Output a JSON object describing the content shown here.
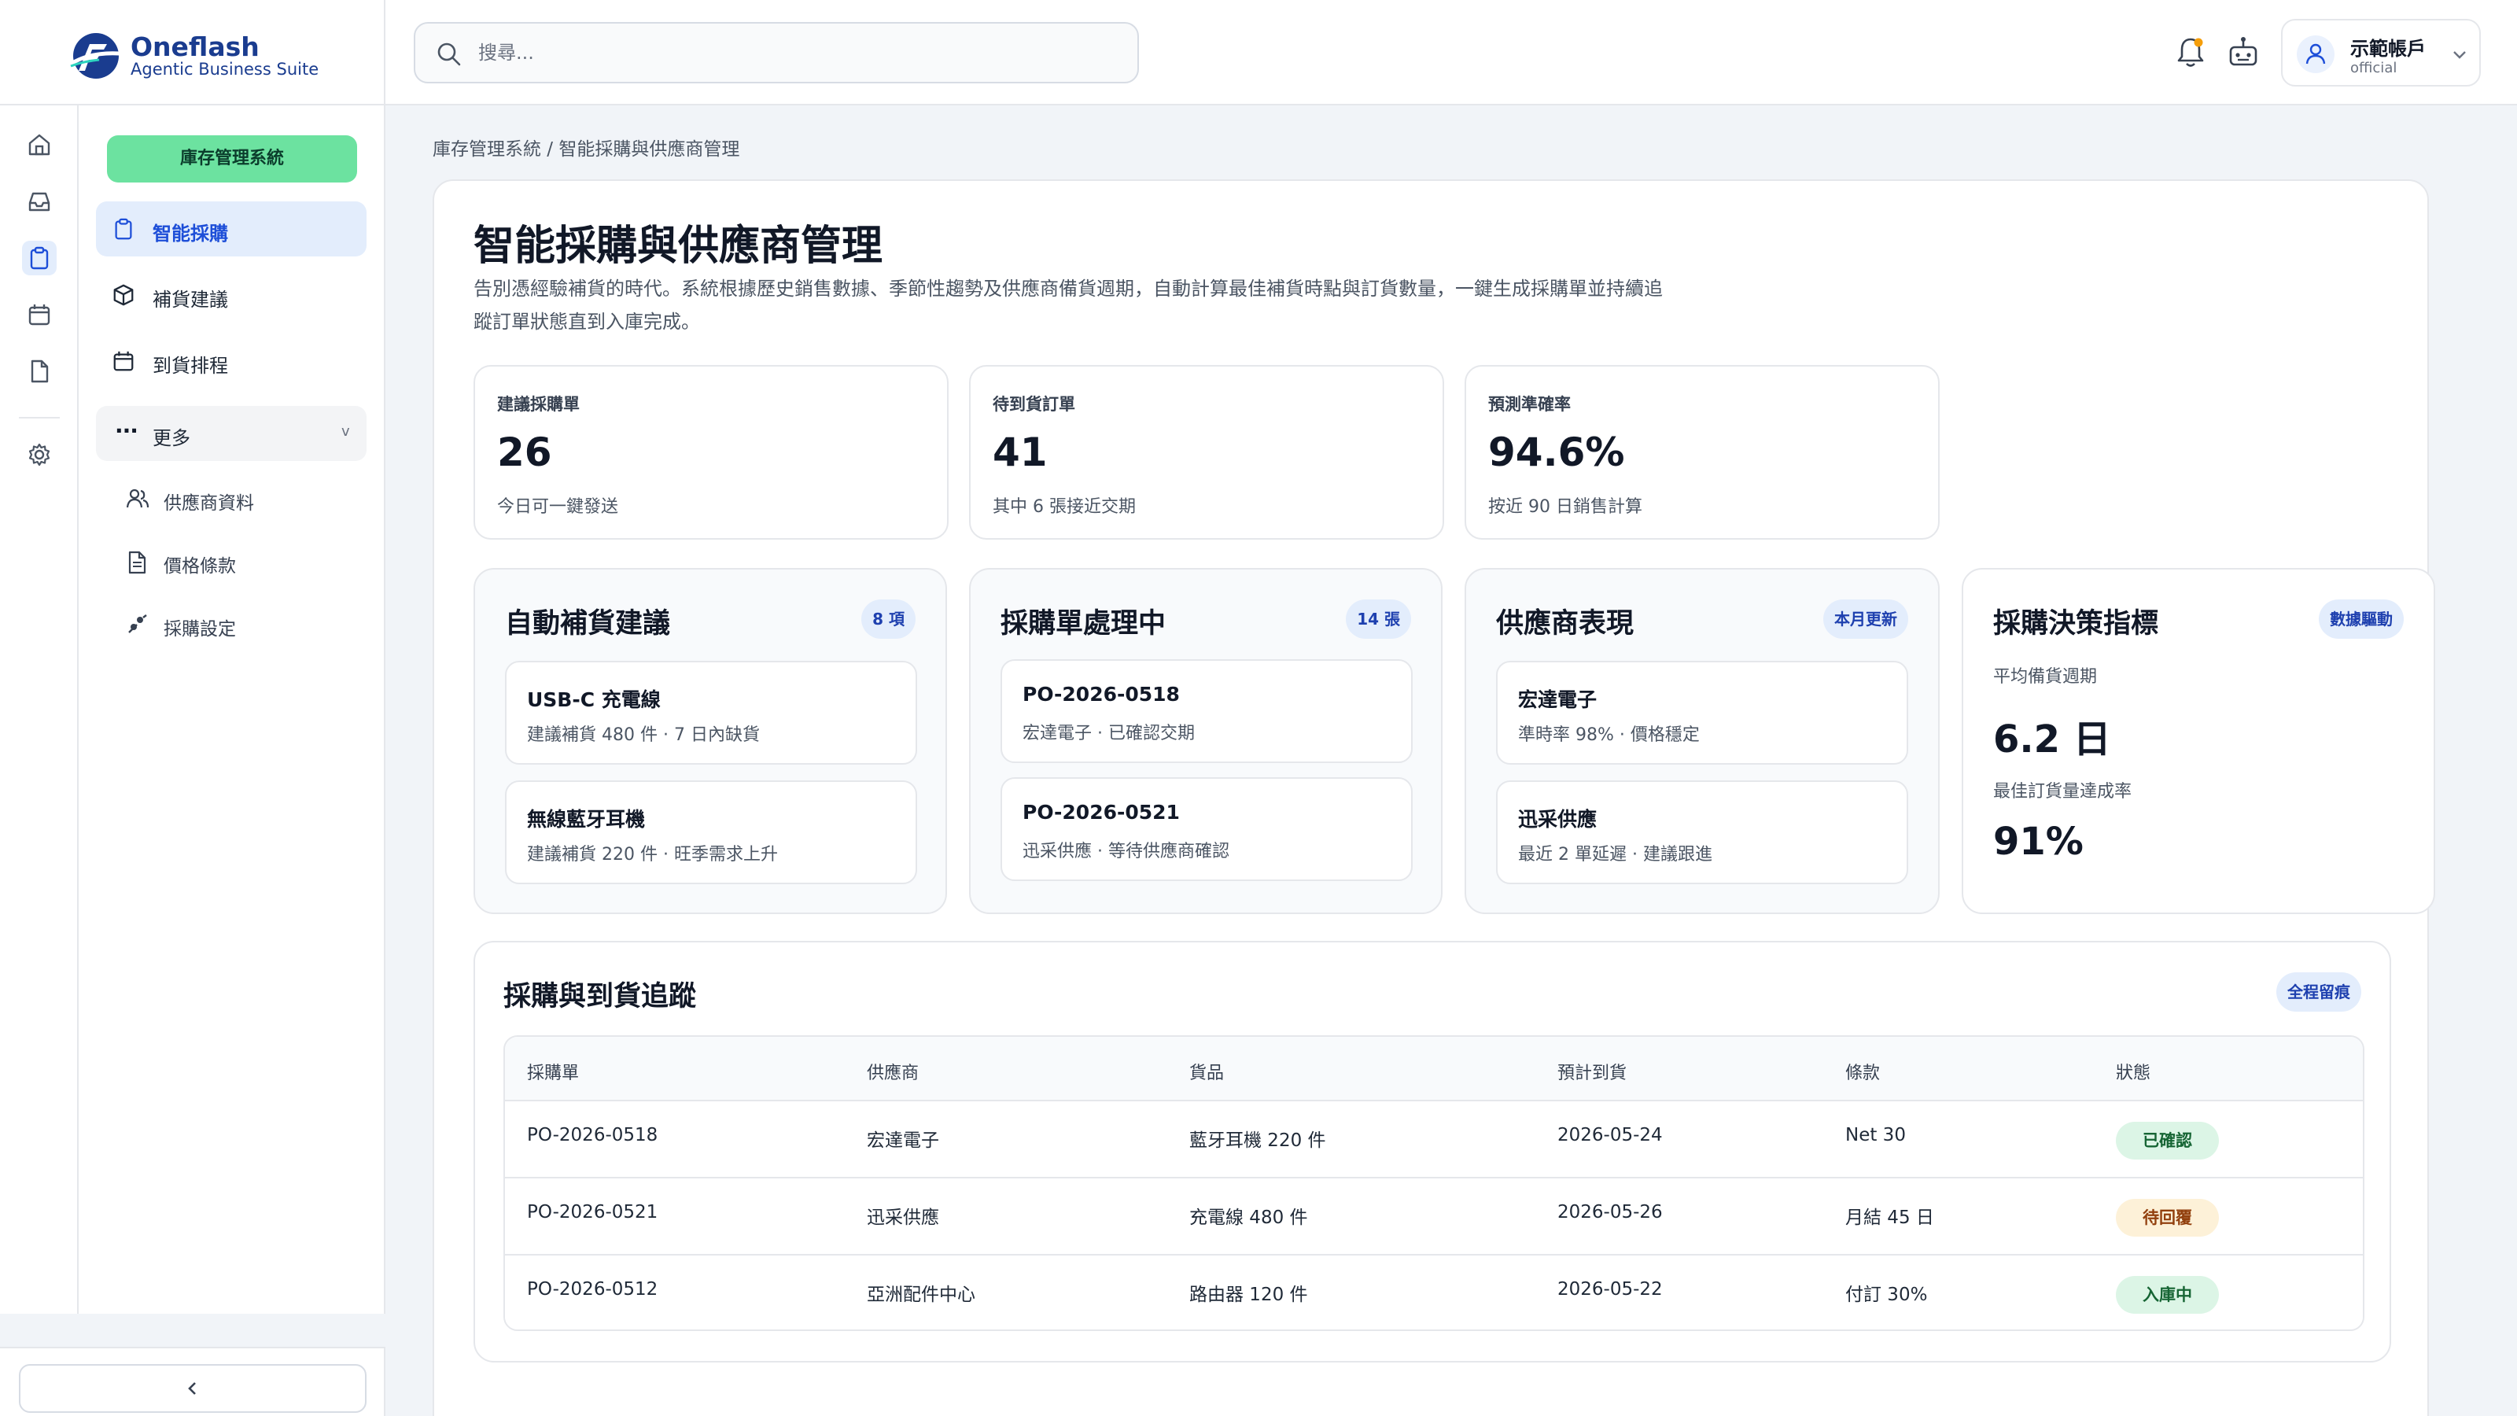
{
  "app": {
    "name": "Oneflash",
    "tagline": "Agentic Business Suite"
  },
  "header": {
    "search_placeholder": "搜尋...",
    "account_name": "示範帳戶",
    "account_role": "official"
  },
  "sidebar": {
    "system_button": "庫存管理系統",
    "items": [
      {
        "label": "智能採購",
        "icon": "clipboard-icon",
        "active": true
      },
      {
        "label": "補貨建議",
        "icon": "box-icon",
        "active": false
      },
      {
        "label": "到貨排程",
        "icon": "calendar-icon",
        "active": false
      }
    ],
    "more_label": "更多",
    "more_chevron": "v",
    "sub_items": [
      {
        "label": "供應商資料",
        "icon": "users-icon"
      },
      {
        "label": "價格條款",
        "icon": "document-icon"
      },
      {
        "label": "採購設定",
        "icon": "settings-sliders-icon"
      }
    ]
  },
  "rail": {
    "icons": [
      "home-icon",
      "inbox-icon",
      "clipboard-icon",
      "calendar-icon",
      "document-icon",
      "gear-icon"
    ]
  },
  "breadcrumb": "庫存管理系統 / 智能採購與供應商管理",
  "page": {
    "title": "智能採購與供應商管理",
    "description": "告別憑經驗補貨的時代。系統根據歷史銷售數據、季節性趨勢及供應商備貨週期，自動計算最佳補貨時點與訂貨數量，一鍵生成採購單並持續追蹤訂單狀態直到入庫完成。"
  },
  "stats": [
    {
      "label": "建議採購單",
      "value": "26",
      "sub": "今日可一鍵發送"
    },
    {
      "label": "待到貨訂單",
      "value": "41",
      "sub": "其中 6 張接近交期"
    },
    {
      "label": "預測準確率",
      "value": "94.6%",
      "sub": "按近 90 日銷售計算"
    }
  ],
  "cards": {
    "auto_restock": {
      "title": "自動補貨建議",
      "badge": "8 項",
      "items": [
        {
          "title": "USB-C 充電線",
          "sub": "建議補貨 480 件 · 7 日內缺貨"
        },
        {
          "title": "無線藍牙耳機",
          "sub": "建議補貨 220 件 · 旺季需求上升"
        }
      ]
    },
    "po_processing": {
      "title": "採購單處理中",
      "badge": "14 張",
      "items": [
        {
          "title": "PO-2026-0518",
          "sub": "宏達電子 · 已確認交期"
        },
        {
          "title": "PO-2026-0521",
          "sub": "迅采供應 · 等待供應商確認"
        }
      ]
    },
    "supplier_performance": {
      "title": "供應商表現",
      "badge": "本月更新",
      "items": [
        {
          "title": "宏達電子",
          "sub": "準時率 98% · 價格穩定"
        },
        {
          "title": "迅采供應",
          "sub": "最近 2 單延遲 · 建議跟進"
        }
      ]
    },
    "decision_metrics": {
      "title": "採購決策指標",
      "badge": "數據驅動",
      "metric1_label": "平均備貨週期",
      "metric1_value": "6.2 日",
      "metric2_label": "最佳訂貨量達成率",
      "metric2_value": "91%"
    }
  },
  "tracking": {
    "title": "採購與到貨追蹤",
    "badge": "全程留痕",
    "columns": [
      "採購單",
      "供應商",
      "貨品",
      "預計到貨",
      "條款",
      "狀態"
    ],
    "rows": [
      {
        "po": "PO-2026-0518",
        "supplier": "宏達電子",
        "goods": "藍牙耳機 220 件",
        "eta": "2026-05-24",
        "terms": "Net 30",
        "status": "已確認"
      },
      {
        "po": "PO-2026-0521",
        "supplier": "迅采供應",
        "goods": "充電線 480 件",
        "eta": "2026-05-26",
        "terms": "月結 45 日",
        "status": "待回覆"
      },
      {
        "po": "PO-2026-0512",
        "supplier": "亞洲配件中心",
        "goods": "路由器 120 件",
        "eta": "2026-05-22",
        "terms": "付訂 30%",
        "status": "入庫中"
      }
    ]
  },
  "colors": {
    "brand": "#1a3c8f",
    "accent_green": "#6ce2a0",
    "active_bg": "#e3edfc",
    "status_green_bg": "#dcf5e6",
    "status_yellow_bg": "#fdf1d8"
  }
}
